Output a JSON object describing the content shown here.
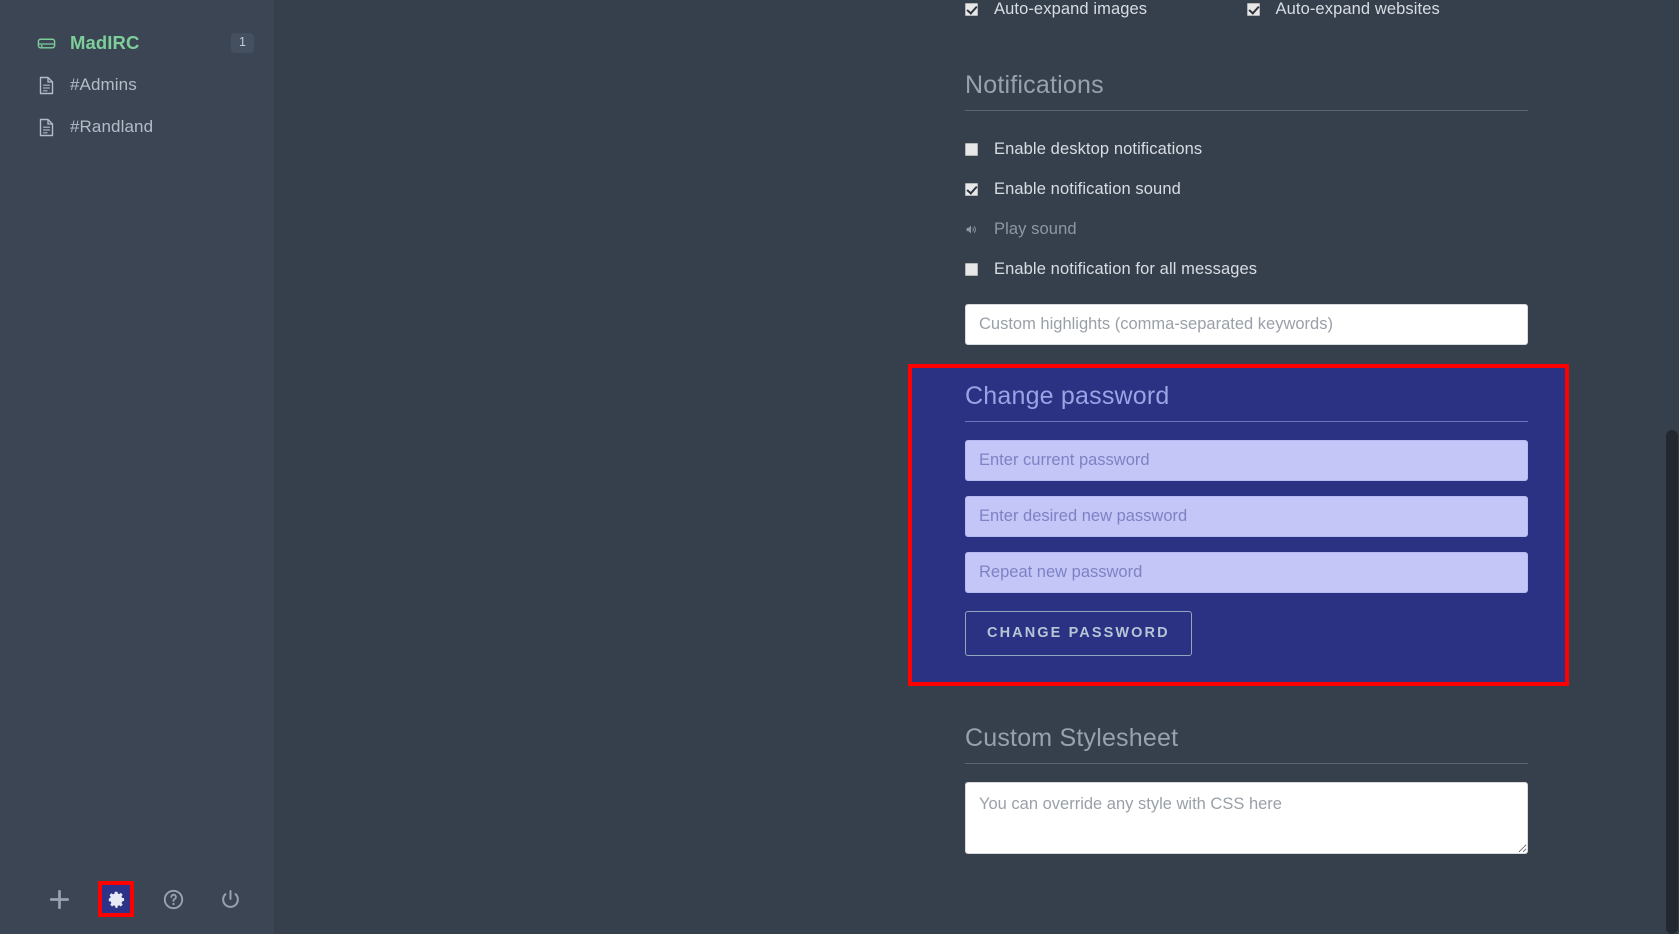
{
  "sidebar": {
    "network": {
      "icon": "server-icon",
      "name": "MadIRC",
      "badge": "1"
    },
    "channels": [
      {
        "icon": "document-icon",
        "name": "#Admins"
      },
      {
        "icon": "document-icon",
        "name": "#Randland"
      }
    ],
    "footer": {
      "add_label": "plus-icon",
      "settings_label": "gear-icon",
      "help_label": "help-icon",
      "signout_label": "power-icon"
    }
  },
  "main": {
    "top_checkboxes": [
      {
        "label": "Auto-expand images",
        "checked": true
      },
      {
        "label": "Auto-expand websites",
        "checked": true
      }
    ],
    "notifications": {
      "title": "Notifications",
      "checkboxes": [
        {
          "label": "Enable desktop notifications",
          "checked": false
        },
        {
          "label": "Enable notification sound",
          "checked": true
        }
      ],
      "play_sound": {
        "icon": "speaker-icon",
        "label": "Play sound"
      },
      "all_messages": {
        "label": "Enable notification for all messages",
        "checked": false
      },
      "highlights_input": {
        "placeholder": "Custom highlights (comma-separated keywords)",
        "value": ""
      }
    },
    "change_password": {
      "title": "Change password",
      "fields": [
        {
          "placeholder": "Enter current password",
          "value": ""
        },
        {
          "placeholder": "Enter desired new password",
          "value": ""
        },
        {
          "placeholder": "Repeat new password",
          "value": ""
        }
      ],
      "submit_label": "CHANGE PASSWORD"
    },
    "custom_stylesheet": {
      "title": "Custom Stylesheet",
      "placeholder": "You can override any style with CSS here",
      "value": ""
    }
  },
  "colors": {
    "sidebar_bg": "#3b4553",
    "main_bg": "#36404d",
    "network_green": "#7ece9b",
    "selection_bg": "#2b3183",
    "selection_input_bg": "#c4c6f7",
    "highlight_box_border": "#ff0000",
    "scrollbar_thumb": "#232830"
  }
}
